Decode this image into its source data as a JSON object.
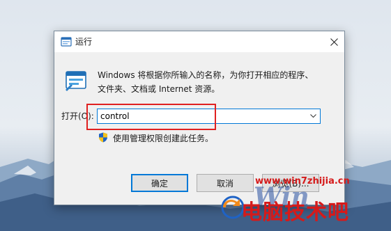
{
  "dialog": {
    "title": "运行",
    "description_line1": "Windows 将根据你所输入的名称，为你打开相应的程序、",
    "description_line2": "文件夹、文档或 Internet 资源。",
    "open_label": "打开(O):",
    "command_value": "control",
    "admin_note": "使用管理权限创建此任务。",
    "ok_label": "确定",
    "cancel_label": "取消",
    "browse_label": "浏览(B)..."
  },
  "icons": {
    "title": "run-icon",
    "close": "close-icon",
    "run": "run-app-icon",
    "dropdown": "chevron-down-icon",
    "shield": "uac-shield-icon"
  },
  "watermark": {
    "url": "www.win7zhijia.cn",
    "logo_text": "Win",
    "text": "电脑技术吧"
  },
  "colors": {
    "accent": "#0078d7",
    "highlight": "#e02020",
    "watermark": "#d51a1a"
  }
}
